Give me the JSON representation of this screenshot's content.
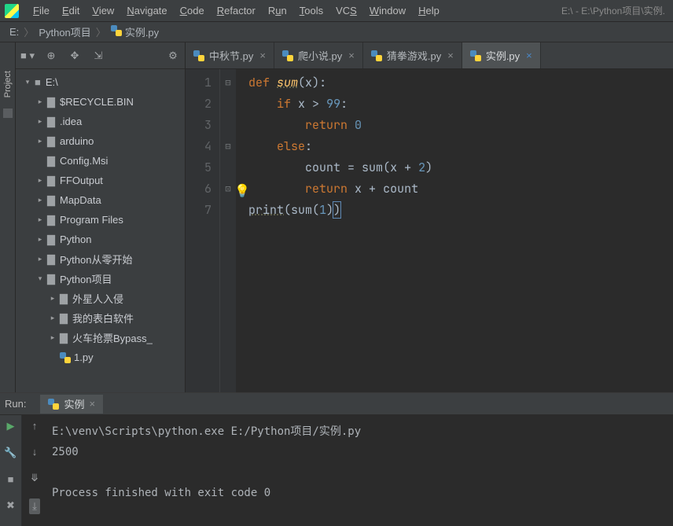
{
  "app": {
    "path_title": "E:\\ - E:\\Python项目\\实例."
  },
  "menu": {
    "file": "File",
    "edit": "Edit",
    "view": "View",
    "navigate": "Navigate",
    "code": "Code",
    "refactor": "Refactor",
    "run": "Run",
    "tools": "Tools",
    "vcs": "VCS",
    "window": "Window",
    "help": "Help"
  },
  "breadcrumbs": {
    "root": "E:",
    "dir": "Python项目",
    "file": "实例.py"
  },
  "sidebar": {
    "project_label": "Project"
  },
  "tree": {
    "root": "E:\\",
    "items": [
      "$RECYCLE.BIN",
      ".idea",
      "arduino",
      "Config.Msi",
      "FFOutput",
      "MapData",
      "Program Files",
      "Python",
      "Python从零开始",
      "Python项目"
    ],
    "nest": [
      "外星人入侵",
      "我的表白软件",
      "火车抢票Bypass_"
    ],
    "file": "1.py"
  },
  "tabs": [
    {
      "label": "中秋节.py",
      "active": false
    },
    {
      "label": "爬小说.py",
      "active": false
    },
    {
      "label": "猜拳游戏.py",
      "active": false
    },
    {
      "label": "实例.py",
      "active": true
    }
  ],
  "code": {
    "lines": [
      "1",
      "2",
      "3",
      "4",
      "5",
      "6",
      "7"
    ],
    "l1_def": "def ",
    "l1_name": "sum",
    "l1_rest1": "(",
    "l1_rest2": "x",
    "l1_rest3": "):",
    "l2_if": "if ",
    "l2_rest1": "x ",
    "l2_op": "> ",
    "l2_num": "99",
    "l2_colon": ":",
    "l3_ret": "return ",
    "l3_num": "0",
    "l4_else": "else",
    "l4_colon": ":",
    "l5_a": "count ",
    "l5_eq": "= ",
    "l5_call": "sum",
    "l5_p1": "(",
    "l5_x": "x ",
    "l5_plus": "+ ",
    "l5_two": "2",
    "l5_p2": ")",
    "l6_ret": "return ",
    "l6_rest": "x ",
    "l6_plus": "+ ",
    "l6_count": "count",
    "l7_print": "print",
    "l7_p1": "(",
    "l7_sum": "sum",
    "l7_p2": "(",
    "l7_one": "1",
    "l7_p3": ")",
    "l7_p4": ")"
  },
  "run": {
    "label": "Run:",
    "tab": "实例",
    "line1": "E:\\venv\\Scripts\\python.exe E:/Python项目/实例.py",
    "line2": "2500",
    "line3": "Process finished with exit code 0"
  }
}
